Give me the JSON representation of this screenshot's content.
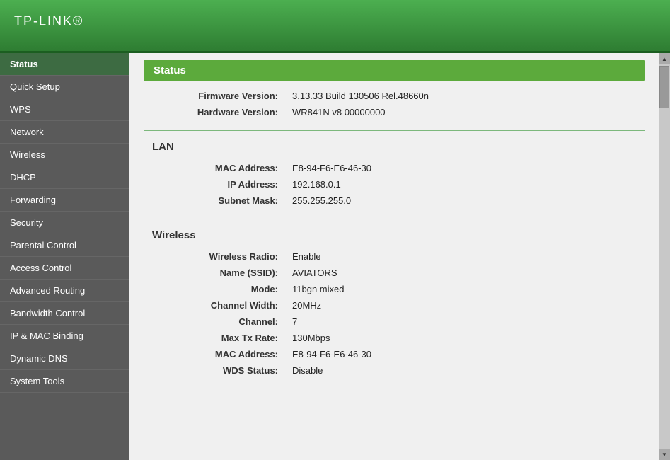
{
  "header": {
    "logo": "TP-LINK",
    "logo_tm": "®"
  },
  "sidebar": {
    "items": [
      {
        "label": "Status",
        "active": true
      },
      {
        "label": "Quick Setup",
        "active": false
      },
      {
        "label": "WPS",
        "active": false
      },
      {
        "label": "Network",
        "active": false
      },
      {
        "label": "Wireless",
        "active": false
      },
      {
        "label": "DHCP",
        "active": false
      },
      {
        "label": "Forwarding",
        "active": false
      },
      {
        "label": "Security",
        "active": false
      },
      {
        "label": "Parental Control",
        "active": false
      },
      {
        "label": "Access Control",
        "active": false
      },
      {
        "label": "Advanced Routing",
        "active": false
      },
      {
        "label": "Bandwidth Control",
        "active": false
      },
      {
        "label": "IP & MAC Binding",
        "active": false
      },
      {
        "label": "Dynamic DNS",
        "active": false
      },
      {
        "label": "System Tools",
        "active": false
      }
    ]
  },
  "main": {
    "page_title": "Status",
    "firmware": {
      "label": "Firmware Version:",
      "value": "3.13.33 Build 130506 Rel.48660n"
    },
    "hardware": {
      "label": "Hardware Version:",
      "value": "WR841N v8 00000000"
    },
    "lan": {
      "title": "LAN",
      "mac_label": "MAC Address:",
      "mac_value": "E8-94-F6-E6-46-30",
      "ip_label": "IP Address:",
      "ip_value": "192.168.0.1",
      "subnet_label": "Subnet Mask:",
      "subnet_value": "255.255.255.0"
    },
    "wireless": {
      "title": "Wireless",
      "radio_label": "Wireless Radio:",
      "radio_value": "Enable",
      "ssid_label": "Name (SSID):",
      "ssid_value": "AVIATORS",
      "mode_label": "Mode:",
      "mode_value": "11bgn mixed",
      "channel_width_label": "Channel Width:",
      "channel_width_value": "20MHz",
      "channel_label": "Channel:",
      "channel_value": "7",
      "max_tx_label": "Max Tx Rate:",
      "max_tx_value": "130Mbps",
      "mac_label": "MAC Address:",
      "mac_value": "E8-94-F6-E6-46-30",
      "wds_label": "WDS Status:",
      "wds_value": "Disable"
    }
  }
}
